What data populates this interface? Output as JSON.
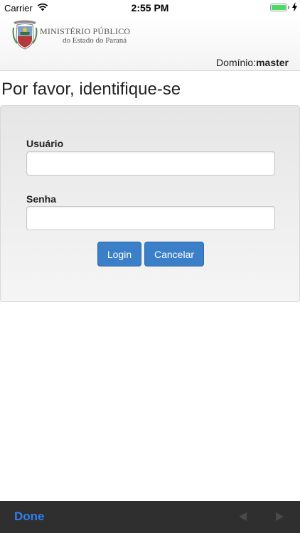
{
  "status_bar": {
    "carrier": "Carrier",
    "time": "2:55 PM",
    "battery_color": "#4cd964"
  },
  "header": {
    "org_line1": "MINISTÉRIO PÚBLICO",
    "org_line2": "do Estado do Paraná",
    "logo_icon": "coat-of-arms-icon",
    "domain_label": "Domínio:",
    "domain_value": "master"
  },
  "page": {
    "title": "Por favor, identifique-se"
  },
  "login_form": {
    "username_label": "Usuário",
    "username_value": "",
    "password_label": "Senha",
    "password_value": "",
    "login_button": "Login",
    "cancel_button": "Cancelar",
    "button_color": "#3a7fc8"
  },
  "toolbar": {
    "done_label": "Done",
    "done_color": "#2f7ff2",
    "prev_icon": "previous-arrow-icon",
    "next_icon": "next-arrow-icon"
  }
}
